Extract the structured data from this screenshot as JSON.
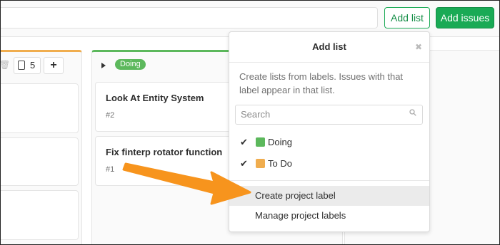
{
  "header": {
    "add_list_label": "Add list",
    "add_issues_label": "Add issues"
  },
  "lists": {
    "left": {
      "count": "5",
      "accent": "#f0ad4e"
    },
    "doing": {
      "label": "Doing",
      "accent": "#5cb85c",
      "cards": [
        {
          "title": "Look At Entity System",
          "number": "#2"
        },
        {
          "title": "Fix finterp rotator function",
          "number": "#1"
        }
      ]
    }
  },
  "dropdown": {
    "title": "Add list",
    "description": "Create lists from labels. Issues with that label appear in that list.",
    "search_placeholder": "Search",
    "labels": [
      {
        "name": "Doing",
        "color": "#5cb85c",
        "checked": true
      },
      {
        "name": "To Do",
        "color": "#f0ad4e",
        "checked": true
      }
    ],
    "create_label": "Create project label",
    "manage_label": "Manage project labels"
  },
  "colors": {
    "primary_green": "#1aaa55",
    "arrow_orange": "#f7941d"
  }
}
